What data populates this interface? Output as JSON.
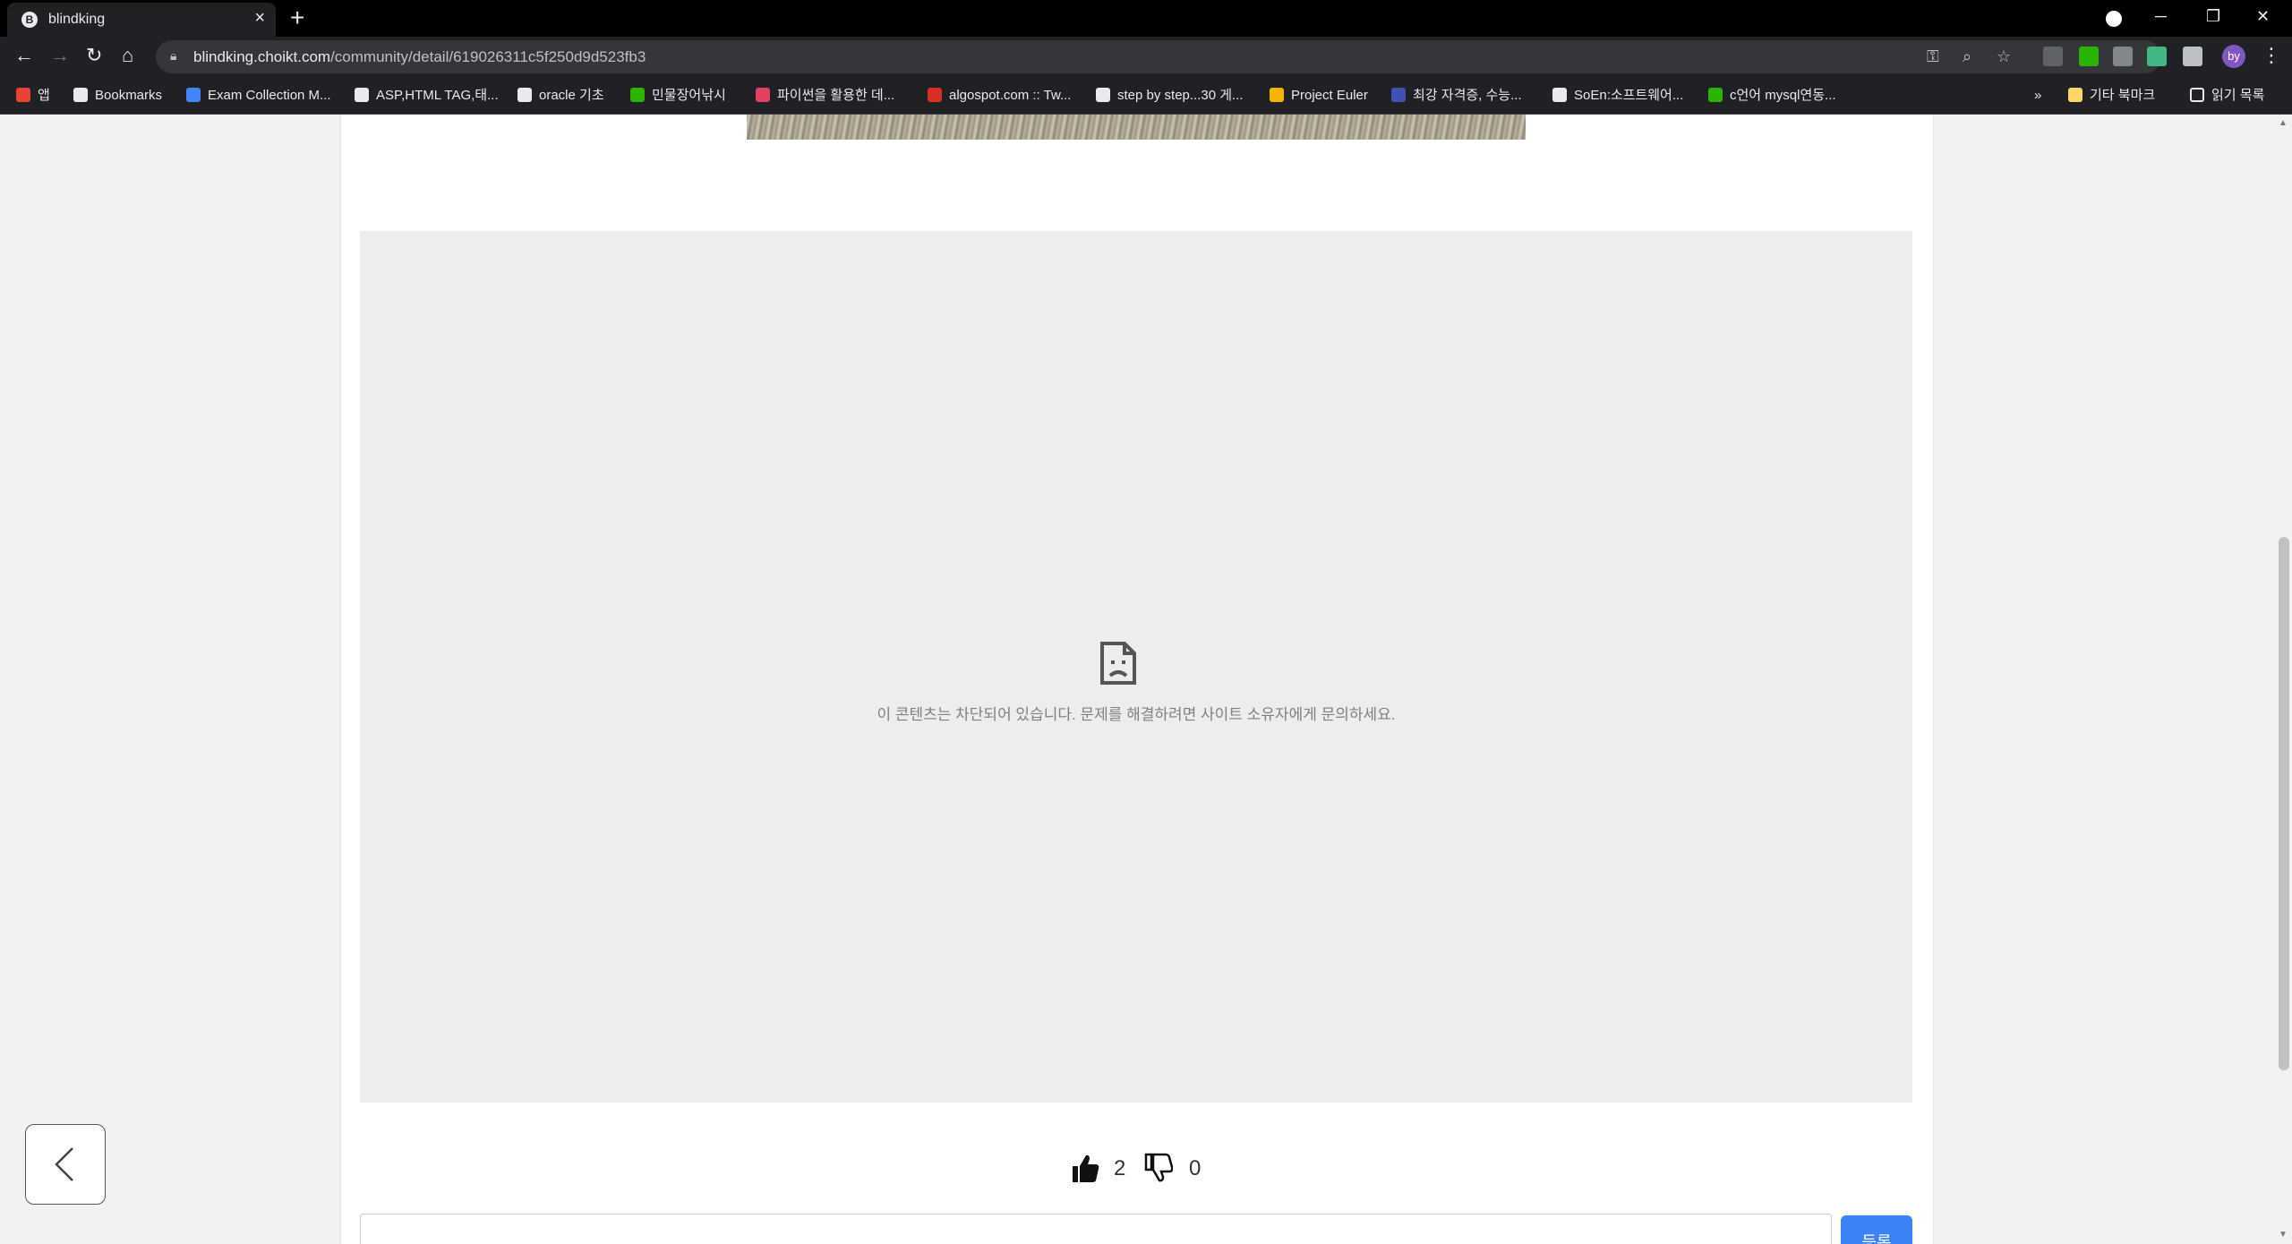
{
  "tab": {
    "title": "blindking",
    "favicon": "B"
  },
  "address": {
    "host": "blindking.choikt.com",
    "path": "/community/detail/619026311c5f250d9d523fb3"
  },
  "bookmarks": {
    "items": [
      {
        "label": "앱",
        "color": "#ea4335"
      },
      {
        "label": "Bookmarks",
        "color": "#e8eaed"
      },
      {
        "label": "Exam Collection M...",
        "color": "#4285f4"
      },
      {
        "label": "ASP,HTML TAG,태...",
        "color": "#e8eaed"
      },
      {
        "label": "oracle 기초",
        "color": "#e8eaed"
      },
      {
        "label": "민물장어낚시",
        "color": "#2db400"
      },
      {
        "label": "파이썬을 활용한 데...",
        "color": "#e4405f"
      },
      {
        "label": "algospot.com :: Tw...",
        "color": "#d93025"
      },
      {
        "label": "step by step...30 게...",
        "color": "#e8eaed"
      },
      {
        "label": "Project Euler",
        "color": "#f4b400"
      },
      {
        "label": "최강 자격증, 수능...",
        "color": "#3f51b5"
      },
      {
        "label": "SoEn:소프트웨어...",
        "color": "#e8eaed"
      },
      {
        "label": "c언어 mysql연동...",
        "color": "#2db400"
      }
    ],
    "overflow": "»",
    "other_folder": "기타 북마크",
    "reading_list": "읽기 목록"
  },
  "content": {
    "blocked_message": "이 콘텐츠는 차단되어 있습니다. 문제를 해결하려면 사이트 소유자에게 문의하세요."
  },
  "votes": {
    "likes": "2",
    "dislikes": "0"
  },
  "comment": {
    "submit_label": "등록"
  }
}
